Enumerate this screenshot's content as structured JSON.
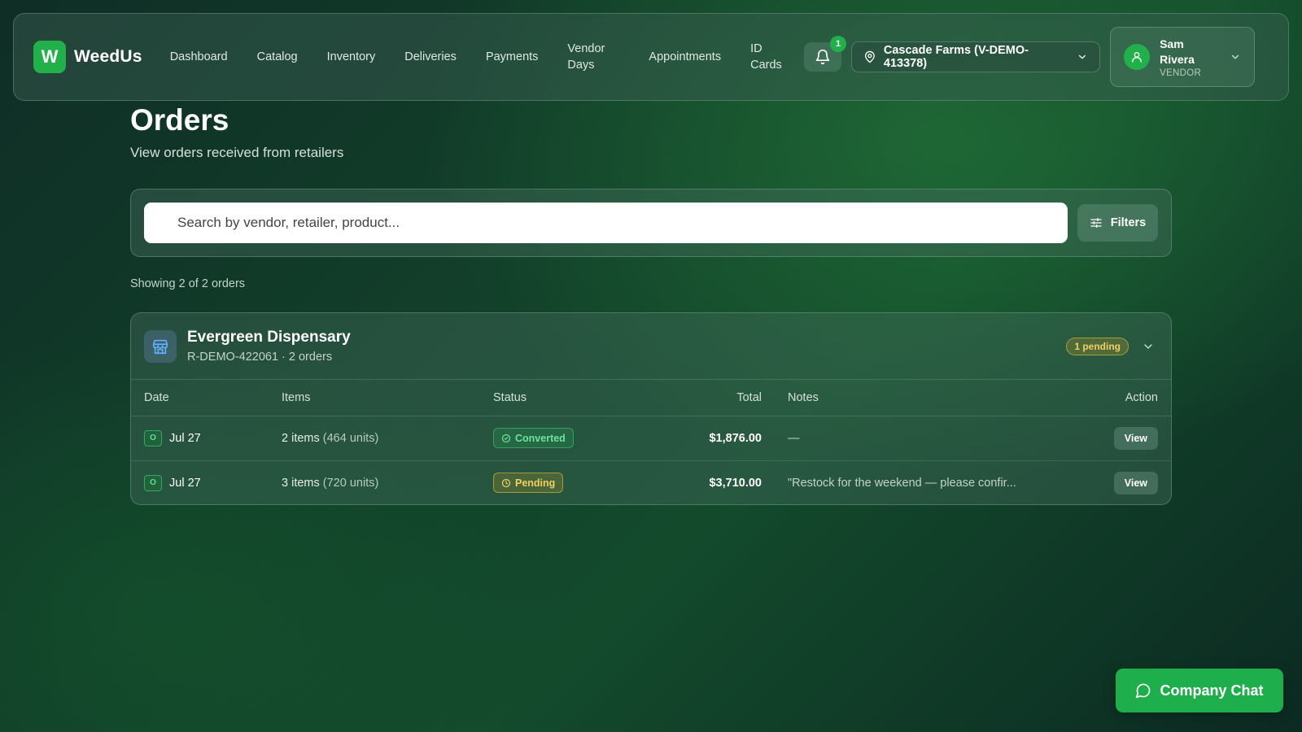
{
  "app": {
    "logo_letter": "W",
    "name": "WeedUs"
  },
  "nav": {
    "items": [
      {
        "label": "Dashboard"
      },
      {
        "label": "Catalog"
      },
      {
        "label": "Inventory"
      },
      {
        "label": "Deliveries"
      },
      {
        "label": "Payments"
      },
      {
        "label": "Vendor Days"
      },
      {
        "label": "Appointments"
      },
      {
        "label": "ID Cards"
      }
    ]
  },
  "notifications": {
    "count": "1",
    "icon": "bell-icon"
  },
  "location": {
    "label": "Cascade Farms (V-DEMO-413378)",
    "icon": "map-pin-icon"
  },
  "user": {
    "name": "Sam Rivera",
    "role": "VENDOR"
  },
  "page": {
    "title": "Orders",
    "subtitle": "View orders received from retailers"
  },
  "search": {
    "placeholder": "Search by vendor, retailer, product...",
    "value": "",
    "filters_label": "Filters"
  },
  "summary": {
    "showing": "Showing 2 of 2 orders"
  },
  "group": {
    "name": "Evergreen Dispensary",
    "meta": "R-DEMO-422061 · 2 orders",
    "pending_badge": "1 pending",
    "columns": [
      "Date",
      "Items",
      "Status",
      "Total",
      "Notes",
      "Action"
    ],
    "rows": [
      {
        "marker": "O",
        "date": "Jul 27",
        "items": "2 items",
        "units": "(464 units)",
        "status": "Converted",
        "total": "$1,876.00",
        "notes": "—",
        "action": "View"
      },
      {
        "marker": "O",
        "date": "Jul 27",
        "items": "3 items",
        "units": "(720 units)",
        "status": "Pending",
        "total": "$3,710.00",
        "notes": "\"Restock for the weekend — please confir...",
        "action": "View"
      }
    ]
  },
  "chat": {
    "label": "Company Chat"
  },
  "colors": {
    "brand": "#22b04b",
    "pending": "#f2d060",
    "converted": "#6ae59a"
  }
}
